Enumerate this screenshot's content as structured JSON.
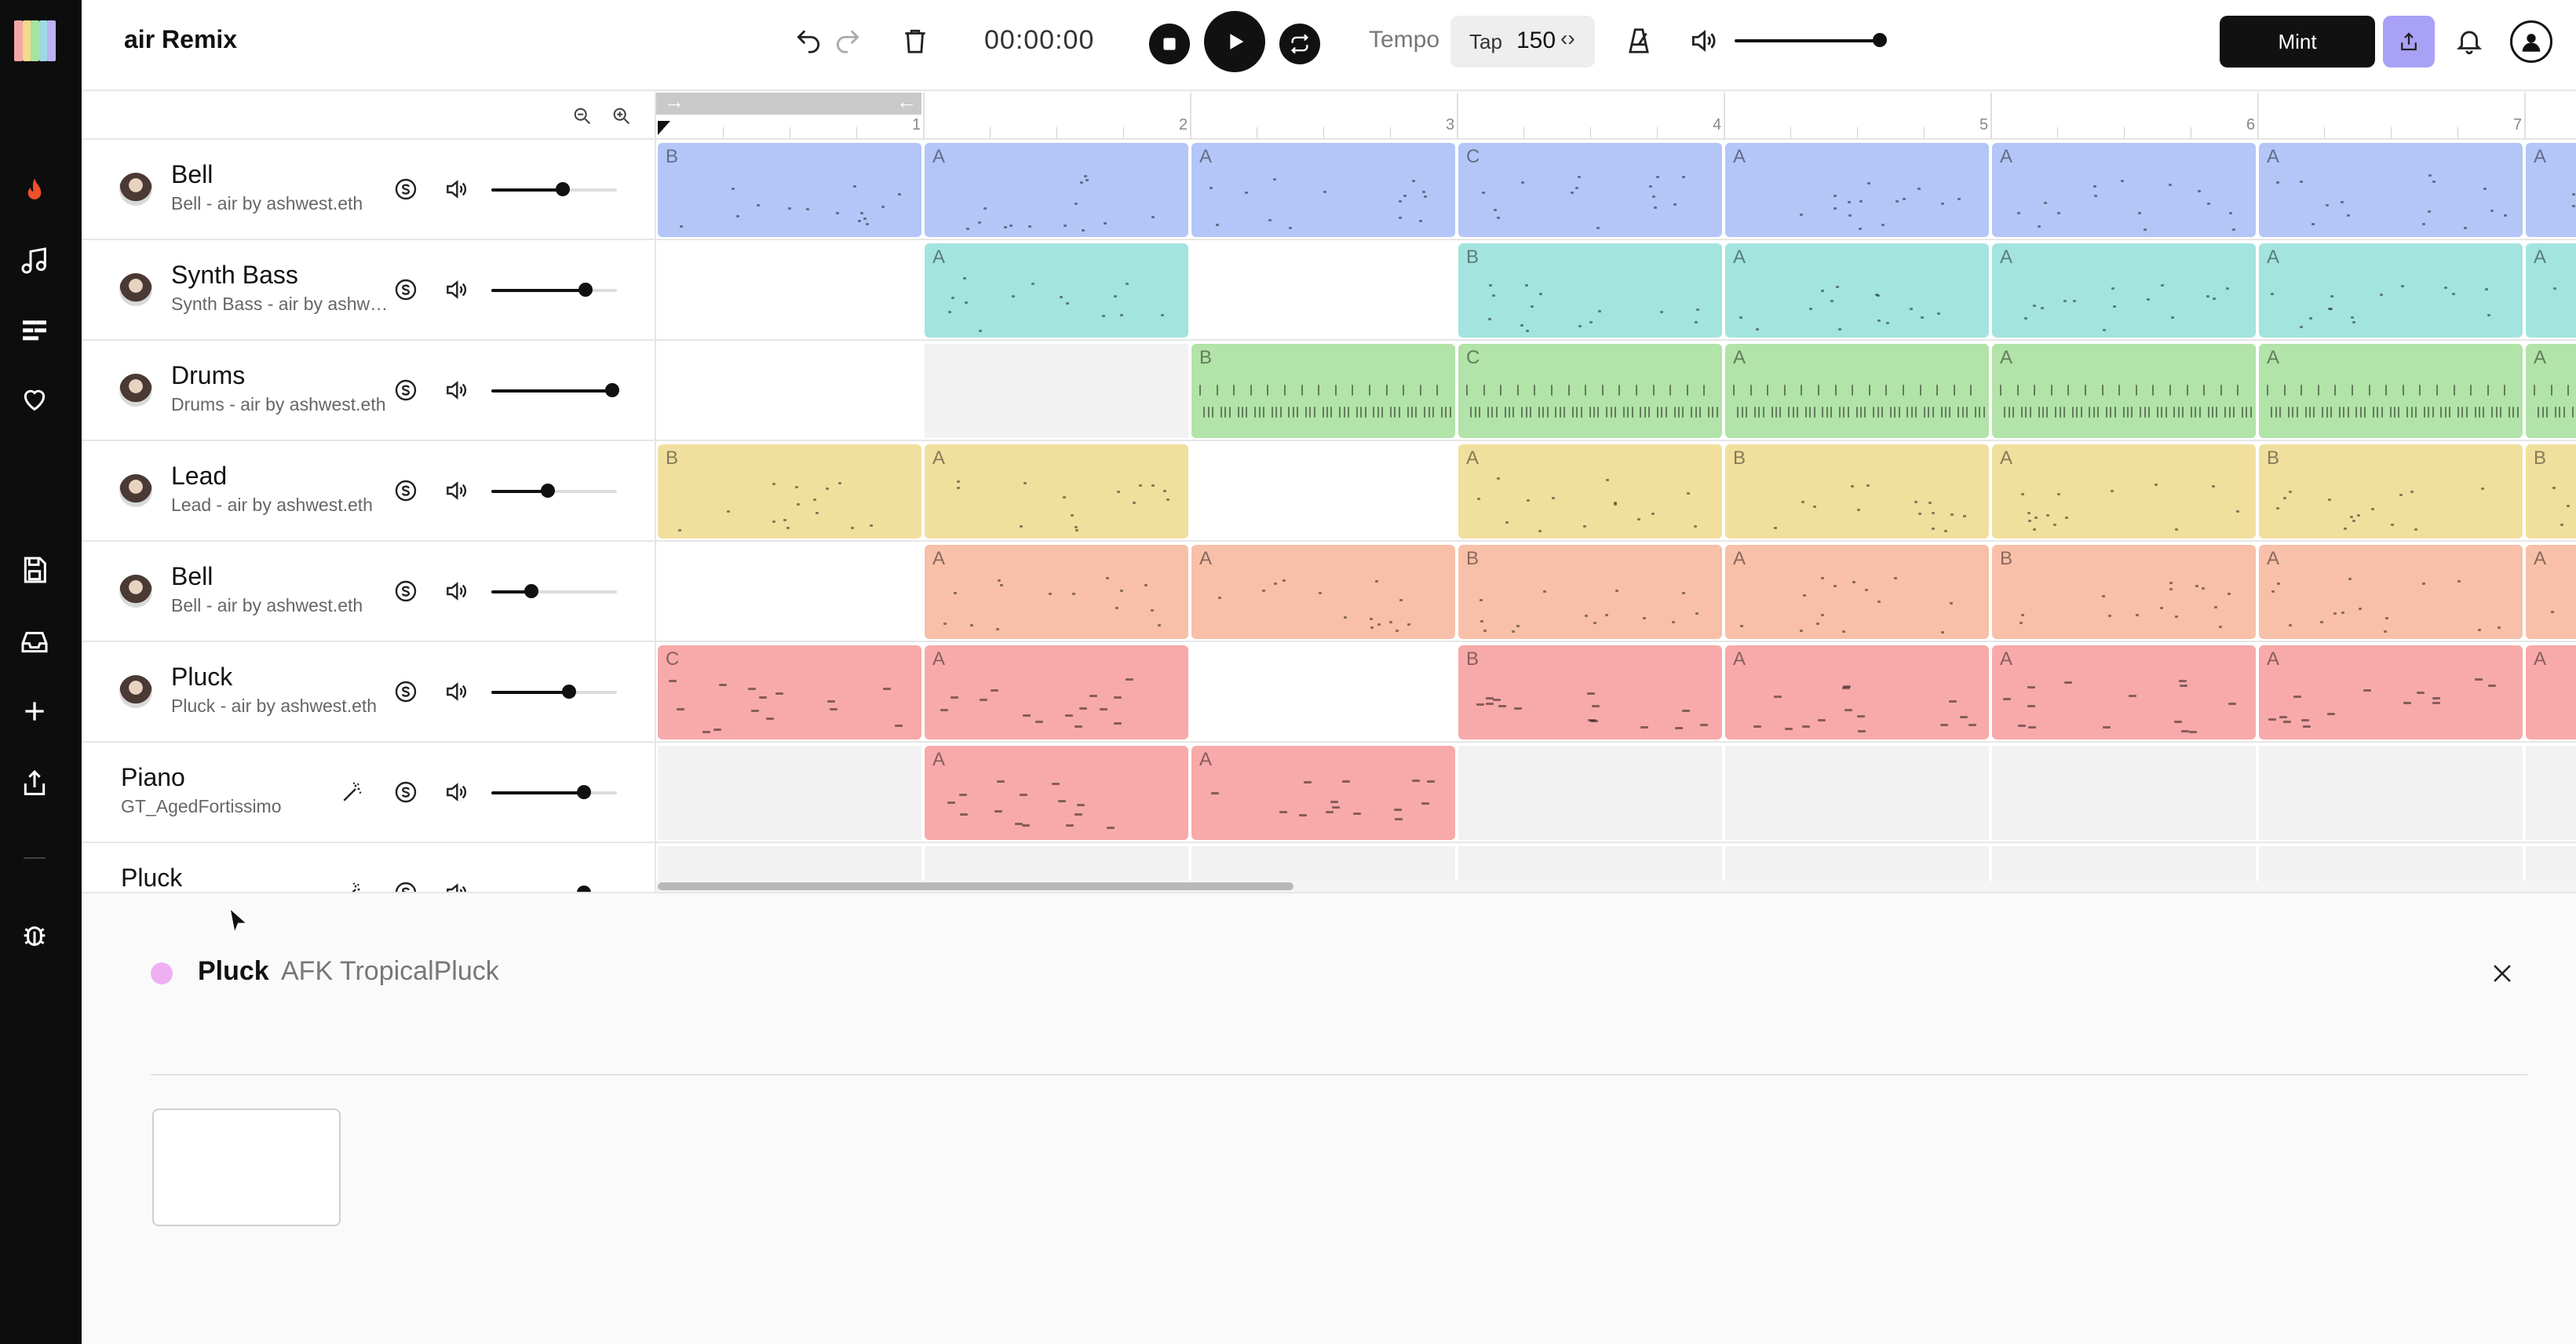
{
  "app": {
    "title": "air Remix",
    "logo_colors": [
      "#f4a6a6",
      "#f3d98a",
      "#a7e3a0",
      "#9fd8e6",
      "#b9b3f3"
    ]
  },
  "transport": {
    "time": "00:00:00",
    "tempo_label": "Tempo",
    "tap_label": "Tap",
    "tempo_value": "150",
    "tempo_arrows": "‹›",
    "volume_level": 0.9,
    "mint_label": "Mint"
  },
  "tracks": [
    {
      "name": "Bell",
      "sub": "Bell - air by ashwest.eth",
      "avatar": true,
      "magic": false,
      "volume": 0.57
    },
    {
      "name": "Synth Bass",
      "sub": "Synth Bass - air by ashwest.eth",
      "avatar": true,
      "magic": false,
      "volume": 0.75
    },
    {
      "name": "Drums",
      "sub": "Drums - air by ashwest.eth",
      "avatar": true,
      "magic": false,
      "volume": 0.96
    },
    {
      "name": "Lead",
      "sub": "Lead - air by ashwest.eth",
      "avatar": true,
      "magic": false,
      "volume": 0.45
    },
    {
      "name": "Bell",
      "sub": "Bell - air by ashwest.eth",
      "avatar": true,
      "magic": false,
      "volume": 0.32
    },
    {
      "name": "Pluck",
      "sub": "Pluck - air by ashwest.eth",
      "avatar": true,
      "magic": false,
      "volume": 0.62
    },
    {
      "name": "Piano",
      "sub": "GT_AgedFortissimo",
      "avatar": false,
      "magic": true,
      "volume": 0.74
    },
    {
      "name": "Pluck",
      "sub": "",
      "avatar": false,
      "magic": true,
      "volume": 0.74
    }
  ],
  "ruler": {
    "bars": [
      "1",
      "2",
      "3",
      "4",
      "5",
      "6",
      "7"
    ],
    "loop_start": "→",
    "loop_end": "←"
  },
  "lanes": [
    {
      "color": "#b3c6f7",
      "clips": [
        {
          "bar": 0,
          "label": "B"
        },
        {
          "bar": 1,
          "label": "A"
        },
        {
          "bar": 2,
          "label": "A"
        },
        {
          "bar": 3,
          "label": "C"
        },
        {
          "bar": 4,
          "label": "A"
        },
        {
          "bar": 5,
          "label": "A"
        },
        {
          "bar": 6,
          "label": "A"
        },
        {
          "bar": 7,
          "label": "A"
        }
      ]
    },
    {
      "color": "#a3e4df",
      "clips": [
        {
          "bar": 1,
          "label": "A"
        },
        {
          "bar": 3,
          "label": "B"
        },
        {
          "bar": 4,
          "label": "A"
        },
        {
          "bar": 5,
          "label": "A"
        },
        {
          "bar": 6,
          "label": "A"
        },
        {
          "bar": 7,
          "label": "A"
        }
      ]
    },
    {
      "color": "#b2e3a8",
      "clips": [
        {
          "bar": 2,
          "label": "B"
        },
        {
          "bar": 3,
          "label": "C"
        },
        {
          "bar": 4,
          "label": "A"
        },
        {
          "bar": 5,
          "label": "A"
        },
        {
          "bar": 6,
          "label": "A"
        },
        {
          "bar": 7,
          "label": "A"
        }
      ]
    },
    {
      "color": "#f1df9e",
      "clips": [
        {
          "bar": 0,
          "label": "B"
        },
        {
          "bar": 1,
          "label": "A"
        },
        {
          "bar": 3,
          "label": "A"
        },
        {
          "bar": 4,
          "label": "B"
        },
        {
          "bar": 5,
          "label": "A"
        },
        {
          "bar": 6,
          "label": "B"
        },
        {
          "bar": 7,
          "label": "B"
        }
      ]
    },
    {
      "color": "#f8c0a8",
      "clips": [
        {
          "bar": 1,
          "label": "A"
        },
        {
          "bar": 2,
          "label": "A"
        },
        {
          "bar": 3,
          "label": "B"
        },
        {
          "bar": 4,
          "label": "A"
        },
        {
          "bar": 5,
          "label": "B"
        },
        {
          "bar": 6,
          "label": "A"
        },
        {
          "bar": 7,
          "label": "A"
        }
      ]
    },
    {
      "color": "#f7aaa9",
      "clips": [
        {
          "bar": 0,
          "label": "C"
        },
        {
          "bar": 1,
          "label": "A"
        },
        {
          "bar": 3,
          "label": "B"
        },
        {
          "bar": 4,
          "label": "A"
        },
        {
          "bar": 5,
          "label": "A"
        },
        {
          "bar": 6,
          "label": "A"
        },
        {
          "bar": 7,
          "label": "A"
        }
      ]
    },
    {
      "color": "#f7aaa9",
      "clips": [
        {
          "bar": 1,
          "label": "A"
        },
        {
          "bar": 2,
          "label": "A"
        }
      ]
    },
    {
      "color": "#f7aaa9",
      "clips": []
    }
  ],
  "detail_panel": {
    "track_name": "Pluck",
    "instrument": "AFK TropicalPluck",
    "color": "#eeb0f2"
  }
}
